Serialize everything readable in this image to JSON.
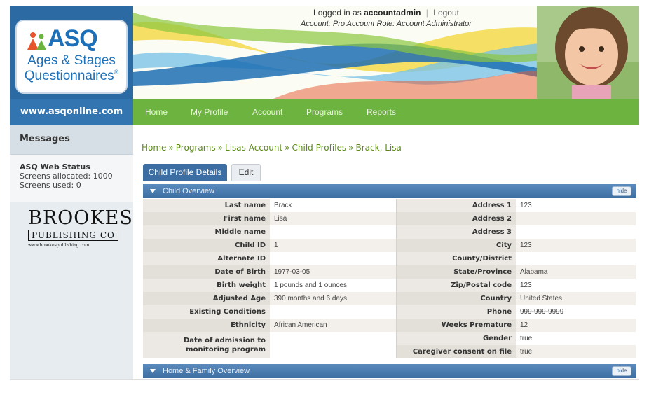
{
  "session": {
    "logged_in_prefix": "Logged in as",
    "username": "accountadmin",
    "logout": "Logout",
    "account_line": "Account: Pro Account Role: Account Administrator"
  },
  "brand": {
    "logo_text": "ASQ",
    "logo_sub1": "Ages & Stages",
    "logo_sub2": "Questionnaires",
    "registered": "®",
    "url": "www.asqonline.com"
  },
  "nav": {
    "items": [
      {
        "label": "Home"
      },
      {
        "label": "My Profile"
      },
      {
        "label": "Account"
      },
      {
        "label": "Programs"
      },
      {
        "label": "Reports"
      }
    ]
  },
  "sidebar": {
    "messages_title": "Messages",
    "status_title": "ASQ Web Status",
    "screens_allocated": "Screens allocated: 1000",
    "screens_used": "Screens used: 0",
    "publisher": {
      "name": "BROOKES",
      "sub": "PUBLISHING CO",
      "url": "www.brookespublishing.com"
    }
  },
  "breadcrumb": [
    "Home",
    "Programs",
    "Lisas Account",
    "Child Profiles",
    "Brack, Lisa"
  ],
  "breadcrumb_sep": "»",
  "tabs": {
    "details": "Child Profile Details",
    "edit": "Edit"
  },
  "sections": {
    "child_overview": "Child Overview",
    "home_family": "Home & Family Overview",
    "hide": "hide"
  },
  "rows": [
    {
      "l1": "Last name",
      "v1": "Brack",
      "l2": "Address 1",
      "v2": "123"
    },
    {
      "l1": "First name",
      "v1": "Lisa",
      "l2": "Address 2",
      "v2": ""
    },
    {
      "l1": "Middle name",
      "v1": "",
      "l2": "Address 3",
      "v2": ""
    },
    {
      "l1": "Child ID",
      "v1": "1",
      "l2": "City",
      "v2": "123"
    },
    {
      "l1": "Alternate ID",
      "v1": "",
      "l2": "County/District",
      "v2": ""
    },
    {
      "l1": "Date of Birth",
      "v1": "1977-03-05",
      "l2": "State/Province",
      "v2": "Alabama"
    },
    {
      "l1": "Birth weight",
      "v1": "1 pounds and 1 ounces",
      "l2": "Zip/Postal code",
      "v2": "123"
    },
    {
      "l1": "Adjusted Age",
      "v1": "390 months and 6 days",
      "l2": "Country",
      "v2": "United States"
    },
    {
      "l1": "Existing Conditions",
      "v1": "",
      "l2": "Phone",
      "v2": "999-999-9999"
    },
    {
      "l1": "Ethnicity",
      "v1": "African American",
      "l2": "Weeks Premature",
      "v2": "12"
    },
    {
      "l1": "Date of admission to monitoring program",
      "v1": "",
      "l2a": "Gender",
      "v2a": "true",
      "l2b": "Caregiver consent on file",
      "v2b": "true"
    }
  ],
  "colors": {
    "nav_green": "#6db33f",
    "brand_blue": "#2b6aa3",
    "section_blue": "#3c6ea3",
    "breadcrumb_green": "#5a8a1a"
  }
}
